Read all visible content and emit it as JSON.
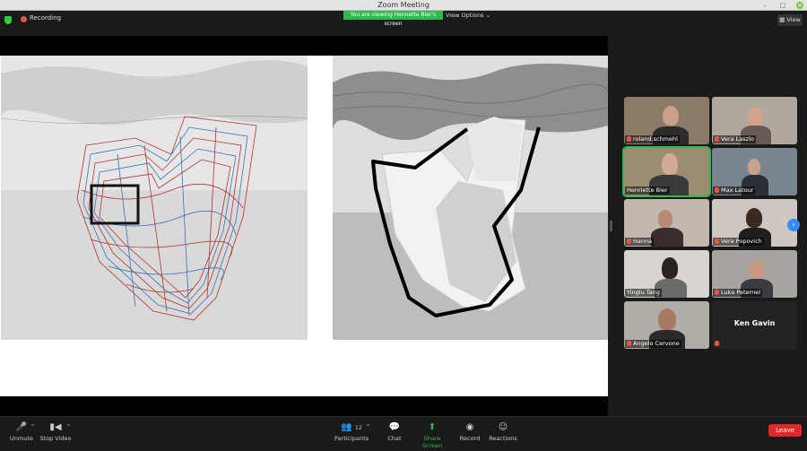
{
  "window": {
    "title": "Zoom Meeting"
  },
  "topbar": {
    "recording_label": "Recording",
    "banner": "You are viewing Hennette Bier's screen",
    "view_options": "View Options",
    "view_button": "View"
  },
  "participants": [
    {
      "name": "roland.schmehl",
      "muted": true
    },
    {
      "name": "Vera Laszlo",
      "muted": true
    },
    {
      "name": "Henriette Bier",
      "muted": false,
      "active": true
    },
    {
      "name": "Max Latour",
      "muted": true
    },
    {
      "name": "Hanna",
      "muted": true
    },
    {
      "name": "Vera Popovich",
      "muted": true
    },
    {
      "name": "Yinglu Tang",
      "muted": false
    },
    {
      "name": "Luka Peternel",
      "muted": true
    },
    {
      "name": "Angelo Cervone",
      "muted": true
    },
    {
      "name": "Ken Gavin",
      "muted": true,
      "video_off": true
    }
  ],
  "toolbar": {
    "unmute": "Unmute",
    "stop_video": "Stop Video",
    "participants": "Participants",
    "participants_count": "12",
    "chat": "Chat",
    "share_screen": "Share Screen",
    "record": "Record",
    "reactions": "Reactions",
    "leave": "Leave"
  },
  "colors": {
    "green": "#2dba4e",
    "leave_red": "#e02828",
    "blue_next": "#2d8cff"
  }
}
